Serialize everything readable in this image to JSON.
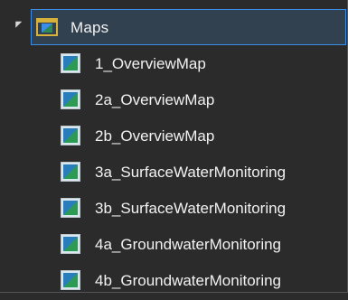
{
  "tree": {
    "root": {
      "label": "Maps",
      "icon": "folder-map-icon",
      "expanded": true
    },
    "items": [
      {
        "label": "1_OverviewMap",
        "icon": "map-icon"
      },
      {
        "label": "2a_OverviewMap",
        "icon": "map-icon"
      },
      {
        "label": "2b_OverviewMap",
        "icon": "map-icon"
      },
      {
        "label": "3a_SurfaceWaterMonitoring",
        "icon": "map-icon"
      },
      {
        "label": "3b_SurfaceWaterMonitoring",
        "icon": "map-icon"
      },
      {
        "label": "4a_GroundwaterMonitoring",
        "icon": "map-icon"
      },
      {
        "label": "4b_GroundwaterMonitoring",
        "icon": "map-icon"
      }
    ]
  },
  "colors": {
    "background": "#2b2b2b",
    "selection_fill": "#324150",
    "selection_border": "#3a8ee6",
    "text": "#f2f2f2"
  }
}
